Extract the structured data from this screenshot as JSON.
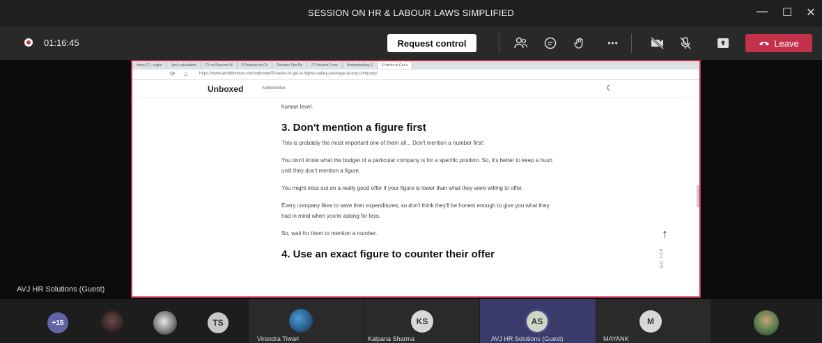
{
  "window": {
    "title": "SESSION ON HR & LABOUR LAWS SIMPLIFIED",
    "minimize_glyph": "—",
    "maximize_glyph": "☐",
    "close_glyph": "✕"
  },
  "call_bar": {
    "timer": "01:16:45",
    "request_control_label": "Request control",
    "leave_label": "Leave",
    "icons": [
      "people-icon",
      "chat-icon",
      "raise-hand-icon",
      "more-icon",
      "camera-off-icon",
      "mic-off-icon",
      "share-icon",
      "phone-icon"
    ],
    "more_glyph": "•••",
    "leave_color": "#c4314b"
  },
  "stage": {
    "presenter_label": "AVJ HR Solutions (Guest)"
  },
  "shared_browser": {
    "tabs": [
      "Inbox (7) - rughe",
      "(pro) calculation",
      "CV vs Resume W",
      "5 Reasons to Ch",
      "Resume Tips Ro",
      "IT Resume Form",
      "Understanding S",
      "5 Hacks to Get a"
    ],
    "url": "https://www.ambitionbox.com/unboxed/5-hacks-to-get-a-higher-salary-package-at-any-company/",
    "site_logo": "Unboxed",
    "site_logo_sub": "AmbitionBox",
    "article": {
      "p0": "human level.",
      "h3": "3. Don't mention a figure first",
      "p1": "This is probably the most important one of them all... Don't mention a number first!",
      "p2": "You don't know what the budget of a particular company is for a specific position. So, it's better to keep a hush until they don't mention a figure.",
      "p3": "You might miss out on a really good offer if your figure is lower than what they were willing to offer.",
      "p4": "Every company likes to save their expenditures, so don't think they'll be honest enough to give you what they had in mind when you're asking for less.",
      "p5": "So, wait for them to mention a number.",
      "h4": "4. Use an exact figure to counter their offer"
    },
    "goto_top_label": "GO TOP"
  },
  "participants": [
    {
      "kind": "count",
      "label": "+15",
      "color": "#6264a7"
    },
    {
      "kind": "photo",
      "label": ""
    },
    {
      "kind": "photo",
      "label": ""
    },
    {
      "kind": "initials",
      "initials": "TS",
      "color": "#c8c8c8"
    },
    {
      "kind": "photo",
      "name": "Virendra Tiwari"
    },
    {
      "kind": "initials",
      "initials": "KS",
      "name": "Kalpana Sharma",
      "color": "#d8d8d8"
    },
    {
      "kind": "initials",
      "initials": "AS",
      "name": "AVJ HR Solutions (Guest)",
      "color": "#cfd6c4"
    },
    {
      "kind": "initials",
      "initials": "M",
      "name": "MAYANK",
      "color": "#d8d8d8"
    },
    {
      "kind": "photo",
      "label": ""
    }
  ]
}
